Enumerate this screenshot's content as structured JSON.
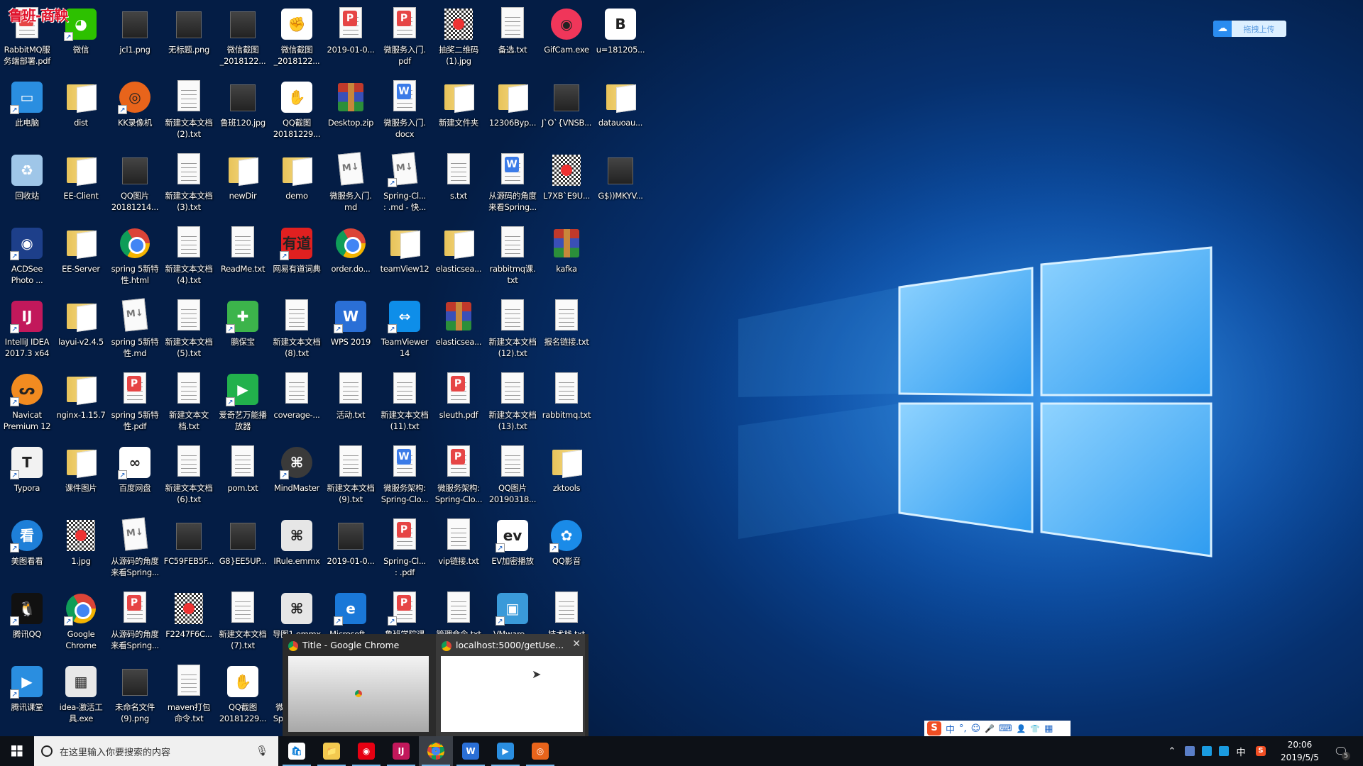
{
  "watermark": "鲁班-商鞅",
  "baidu_upload": {
    "label": "拖拽上传",
    "icon": "baidu-cloud-icon"
  },
  "desktop": {
    "rows": [
      [
        {
          "l": "RabbitMQ服\n务端部署.pdf",
          "t": "pdf"
        },
        {
          "l": "微信",
          "t": "app",
          "c": "#2dc100",
          "g": "◕",
          "s": 1
        },
        {
          "l": "jcl1.png",
          "t": "img"
        },
        {
          "l": "无标题.png",
          "t": "img"
        },
        {
          "l": "微信截图\n_2018122...",
          "t": "img"
        },
        {
          "l": "微信截图\n_2018122...",
          "t": "app",
          "c": "#fff",
          "g": "✊"
        },
        {
          "l": "2019-01-0...",
          "t": "pdf"
        },
        {
          "l": "微服务入门.\npdf",
          "t": "pdf"
        },
        {
          "l": "抽奖二维码\n(1).jpg",
          "t": "qr"
        },
        {
          "l": "备选.txt",
          "t": "txt"
        },
        {
          "l": "GifCam.exe",
          "t": "app",
          "c": "#f0365a",
          "g": "◉",
          "r": 1
        },
        {
          "l": "u=181205...",
          "t": "app",
          "c": "#fff",
          "g": "B"
        }
      ],
      [
        {
          "l": "此电脑",
          "t": "app",
          "c": "#2a8ee0",
          "g": "▭",
          "s": 1
        },
        {
          "l": "dist",
          "t": "folder"
        },
        {
          "l": "KK录像机",
          "t": "app",
          "c": "#e8641b",
          "g": "◎",
          "r": 1,
          "s": 1
        },
        {
          "l": "新建文本文档\n(2).txt",
          "t": "txt"
        },
        {
          "l": "鲁班120.jpg",
          "t": "img"
        },
        {
          "l": "QQ截图\n20181229...",
          "t": "app",
          "c": "#fff",
          "g": "✋"
        },
        {
          "l": "Desktop.zip",
          "t": "zip"
        },
        {
          "l": "微服务入门.\ndocx",
          "t": "word"
        },
        {
          "l": "新建文件夹",
          "t": "folder"
        },
        {
          "l": "12306Byp...",
          "t": "folder"
        },
        {
          "l": "J`O`{VNSB...",
          "t": "img"
        },
        {
          "l": "datauoau...",
          "t": "folder"
        }
      ],
      [
        {
          "l": "回收站",
          "t": "app",
          "c": "#9fc6e8",
          "g": "♻"
        },
        {
          "l": "EE-Client",
          "t": "folder"
        },
        {
          "l": "QQ图片\n20181214...",
          "t": "img"
        },
        {
          "l": "新建文本文档\n(3).txt",
          "t": "txt"
        },
        {
          "l": "newDir",
          "t": "folder"
        },
        {
          "l": "demo",
          "t": "folder"
        },
        {
          "l": "微服务入门.\nmd",
          "t": "md"
        },
        {
          "l": "Spring-Cl...\n: .md - 快...",
          "t": "md",
          "s": 1
        },
        {
          "l": "s.txt",
          "t": "txt"
        },
        {
          "l": "从源码的角度\n来看Spring...",
          "t": "word"
        },
        {
          "l": "L7XB`E9U...",
          "t": "qr"
        },
        {
          "l": "G$))MKYV...",
          "t": "img"
        }
      ],
      [
        {
          "l": "ACDSee\nPhoto ...",
          "t": "app",
          "c": "#1d3f8a",
          "g": "◉",
          "s": 1
        },
        {
          "l": "EE-Server",
          "t": "folder"
        },
        {
          "l": "spring 5新特\n性.html",
          "t": "chrome"
        },
        {
          "l": "新建文本文档\n(4).txt",
          "t": "txt"
        },
        {
          "l": "ReadMe.txt",
          "t": "txt"
        },
        {
          "l": "网易有道词典",
          "t": "app",
          "c": "#e02020",
          "g": "有道",
          "s": 1
        },
        {
          "l": "order.do...",
          "t": "chrome"
        },
        {
          "l": "teamView12",
          "t": "folder"
        },
        {
          "l": "elasticsea...",
          "t": "folder"
        },
        {
          "l": "rabbitmq课.\ntxt",
          "t": "txt"
        },
        {
          "l": "kafka",
          "t": "zip"
        }
      ],
      [
        {
          "l": "IntelliJ IDEA\n2017.3 x64",
          "t": "app",
          "c": "#c2185b",
          "g": "IJ",
          "s": 1
        },
        {
          "l": "layui-v2.4.5",
          "t": "folder"
        },
        {
          "l": "spring 5新特\n性.md",
          "t": "md"
        },
        {
          "l": "新建文本文档\n(5).txt",
          "t": "txt"
        },
        {
          "l": "鹏保宝",
          "t": "app",
          "c": "#3cb44b",
          "g": "✚",
          "s": 1
        },
        {
          "l": "新建文本文档\n(8).txt",
          "t": "txt"
        },
        {
          "l": "WPS 2019",
          "t": "app",
          "c": "#2a6fd6",
          "g": "W",
          "s": 1
        },
        {
          "l": "TeamViewer\n14",
          "t": "app",
          "c": "#0e8ee9",
          "g": "⇔",
          "s": 1
        },
        {
          "l": "elasticsea...",
          "t": "zip"
        },
        {
          "l": "新建文本文档\n(12).txt",
          "t": "txt"
        },
        {
          "l": "报名链接.txt",
          "t": "txt"
        }
      ],
      [
        {
          "l": "Navicat\nPremium 12",
          "t": "app",
          "c": "#f28b20",
          "g": "ᔕ",
          "r": 1,
          "s": 1
        },
        {
          "l": "nginx-1.15.7",
          "t": "folder"
        },
        {
          "l": "spring 5新特\n性.pdf",
          "t": "pdf"
        },
        {
          "l": "新建文本文\n档.txt",
          "t": "txt"
        },
        {
          "l": "爱奇艺万能播\n放器",
          "t": "app",
          "c": "#22b14c",
          "g": "▶",
          "s": 1
        },
        {
          "l": "coverage-...",
          "t": "txt"
        },
        {
          "l": "活动.txt",
          "t": "txt"
        },
        {
          "l": "新建文本文档\n(11).txt",
          "t": "txt"
        },
        {
          "l": "sleuth.pdf",
          "t": "pdf"
        },
        {
          "l": "新建文本文档\n(13).txt",
          "t": "txt"
        },
        {
          "l": "rabbitmq.txt",
          "t": "txt"
        }
      ],
      [
        {
          "l": "Typora",
          "t": "app",
          "c": "#f2f2f2",
          "g": "T",
          "s": 1
        },
        {
          "l": "课件图片",
          "t": "folder"
        },
        {
          "l": "百度网盘",
          "t": "app",
          "c": "#fff",
          "g": "∞",
          "s": 1
        },
        {
          "l": "新建文本文档\n(6).txt",
          "t": "txt"
        },
        {
          "l": "pom.txt",
          "t": "txt"
        },
        {
          "l": "MindMaster",
          "t": "app",
          "c": "#3a3a3a",
          "g": "⌘",
          "r": 1,
          "s": 1
        },
        {
          "l": "新建文本文档\n(9).txt",
          "t": "txt"
        },
        {
          "l": "微服务架构:\nSpring-Clo...",
          "t": "word"
        },
        {
          "l": "微服务架构:\nSpring-Clo...",
          "t": "pdf"
        },
        {
          "l": "QQ图片\n20190318...",
          "t": "txt"
        },
        {
          "l": "zktools",
          "t": "folder"
        }
      ],
      [
        {
          "l": "美图看看",
          "t": "app",
          "c": "#1e7fd8",
          "g": "看",
          "r": 1,
          "s": 1
        },
        {
          "l": "1.jpg",
          "t": "qr"
        },
        {
          "l": "从源码的角度\n来看Spring...",
          "t": "md"
        },
        {
          "l": "FC59FEB5F...",
          "t": "img"
        },
        {
          "l": "G8}EE5UP...",
          "t": "img"
        },
        {
          "l": "IRule.emmx",
          "t": "app",
          "c": "#e6e6e6",
          "g": "⌘"
        },
        {
          "l": "2019-01-0...",
          "t": "img"
        },
        {
          "l": "Spring-Cl...\n: .pdf",
          "t": "pdf"
        },
        {
          "l": "vip链接.txt",
          "t": "txt"
        },
        {
          "l": "EV加密播放",
          "t": "app",
          "c": "#fff",
          "g": "ev",
          "s": 1
        },
        {
          "l": "QQ影音",
          "t": "app",
          "c": "#1a8be8",
          "g": "✿",
          "r": 1,
          "s": 1
        }
      ],
      [
        {
          "l": "腾讯QQ",
          "t": "app",
          "c": "#111",
          "g": "🐧",
          "s": 1
        },
        {
          "l": "Google\nChrome",
          "t": "chrome",
          "s": 1
        },
        {
          "l": "从源码的角度\n来看Spring...",
          "t": "pdf"
        },
        {
          "l": "F2247F6C...",
          "t": "qr"
        },
        {
          "l": "新建文本文档\n(7).txt",
          "t": "txt"
        },
        {
          "l": "导图1.emmx",
          "t": "app",
          "c": "#e6e6e6",
          "g": "⌘"
        },
        {
          "l": "Microsoft...",
          "t": "app",
          "c": "#1a78d8",
          "g": "e",
          "s": 1
        },
        {
          "l": "鲁班学院课堂...",
          "t": "pdf",
          "s": 1
        },
        {
          "l": "管理命令.txt",
          "t": "txt"
        },
        {
          "l": "VMware...",
          "t": "app",
          "c": "#3a9ad9",
          "g": "▣",
          "s": 1
        },
        {
          "l": "技术栈.txt",
          "t": "txt"
        }
      ],
      [
        {
          "l": "腾讯课堂",
          "t": "app",
          "c": "#2a8ee0",
          "g": "▶",
          "s": 1
        },
        {
          "l": "idea-激活工\n具.exe",
          "t": "app",
          "c": "#e8e8e8",
          "g": "▦"
        },
        {
          "l": "未命名文件\n(9).png",
          "t": "img"
        },
        {
          "l": "maven打包\n命令.txt",
          "t": "txt"
        },
        {
          "l": "QQ截图\n20181229...",
          "t": "app",
          "c": "#fff",
          "g": "✋"
        },
        {
          "l": "微服务架构:\nSpring-Clo...",
          "t": "word"
        }
      ]
    ]
  },
  "preview": {
    "windows": [
      {
        "title": "Title - Google Chrome"
      },
      {
        "title": "localhost:5000/getUse..."
      }
    ],
    "close": "✕"
  },
  "ime": {
    "logo": "S",
    "items": [
      "中",
      "°,",
      "☺",
      "🎤",
      "⌨",
      "👤",
      "👕",
      "▦"
    ]
  },
  "taskbar": {
    "search_placeholder": "在这里输入你要搜索的内容",
    "apps": [
      {
        "name": "microsoft-store",
        "g": "🛍"
      },
      {
        "name": "file-explorer",
        "g": "📁"
      },
      {
        "name": "netease-music",
        "g": "◉"
      },
      {
        "name": "intellij-idea",
        "g": "IJ"
      },
      {
        "name": "google-chrome",
        "g": "chrome",
        "active": true
      },
      {
        "name": "wps",
        "g": "W"
      },
      {
        "name": "tencent-classroom",
        "g": "▶"
      },
      {
        "name": "kk-recorder",
        "g": "◎"
      }
    ],
    "tray": {
      "ime_lang": "中",
      "time": "20:06",
      "date": "2019/5/5",
      "notifications": "5"
    }
  }
}
